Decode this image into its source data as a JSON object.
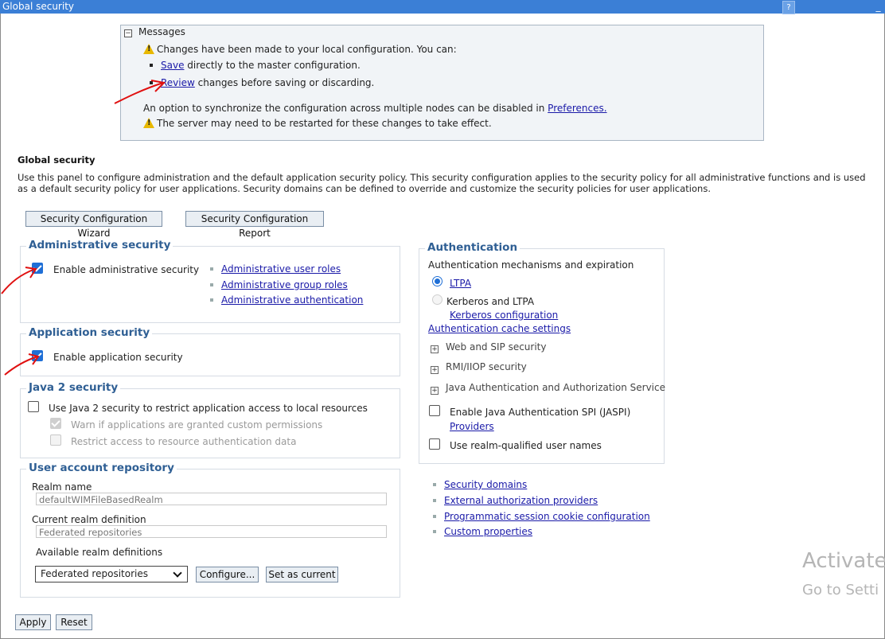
{
  "window": {
    "title": "Global security",
    "help_label": "?",
    "minimize_label": "_"
  },
  "messages": {
    "header": "Messages",
    "changes_notice": "Changes have been made to your local configuration. You can:",
    "save_link": "Save",
    "save_text": "directly to the master configuration.",
    "review_link": "Review",
    "review_text": "changes before saving or discarding.",
    "sync_text": "An option to synchronize the configuration across multiple nodes can be disabled in",
    "preferences_link": "Preferences.",
    "restart_notice": "The server may need to be restarted for these changes to take effect."
  },
  "page": {
    "title": "Global security",
    "description": "Use this panel to configure administration and the default application security policy. This security configuration applies to the security policy for all administrative functions and is used as a default security policy for user applications. Security domains can be defined to override and customize the security policies for user applications."
  },
  "buttons": {
    "wizard": "Security Configuration Wizard",
    "report": "Security Configuration Report",
    "configure": "Configure...",
    "set_current": "Set as current",
    "apply": "Apply",
    "reset": "Reset"
  },
  "admin_security": {
    "legend": "Administrative security",
    "enable_label": "Enable administrative security",
    "enabled": true,
    "links": [
      "Administrative user roles",
      "Administrative group roles",
      "Administrative authentication"
    ]
  },
  "app_security": {
    "legend": "Application security",
    "enable_label": "Enable application security",
    "enabled": true
  },
  "java2_security": {
    "legend": "Java 2 security",
    "use_label": "Use Java 2 security to restrict application access to local resources",
    "use_enabled": false,
    "warn_label": "Warn if applications are granted custom permissions",
    "warn_checked": true,
    "restrict_label": "Restrict access to resource authentication data",
    "restrict_checked": false
  },
  "user_repo": {
    "legend": "User account repository",
    "realm_name_label": "Realm name",
    "realm_name_value": "defaultWIMFileBasedRealm",
    "current_realm_label": "Current realm definition",
    "current_realm_value": "Federated repositories",
    "available_label": "Available realm definitions",
    "available_selected": "Federated repositories"
  },
  "authentication": {
    "legend": "Authentication",
    "mechanisms_label": "Authentication mechanisms and expiration",
    "ltpa_label": "LTPA",
    "ltpa_selected": true,
    "kerberos_label": "Kerberos and LTPA",
    "kerberos_config_link": "Kerberos configuration",
    "cache_link": "Authentication cache settings",
    "expanders": [
      "Web and SIP security",
      "RMI/IIOP security",
      "Java Authentication and Authorization Service"
    ],
    "jaspi_label": "Enable Java Authentication SPI (JASPI)",
    "jaspi_checked": false,
    "providers_link": "Providers",
    "realm_qualified_label": "Use realm-qualified user names",
    "realm_qualified_checked": false
  },
  "other_links": [
    "Security domains",
    "External authorization providers",
    "Programmatic session cookie configuration",
    "Custom properties"
  ],
  "watermark": {
    "line1": "Activate",
    "line2": "Go to Setti"
  },
  "colors": {
    "title_bar": "#3b7fd6",
    "legend": "#2f5f94",
    "link": "#1a1aa8",
    "checkbox": "#1f6fd6",
    "annotation": "#e01010"
  }
}
